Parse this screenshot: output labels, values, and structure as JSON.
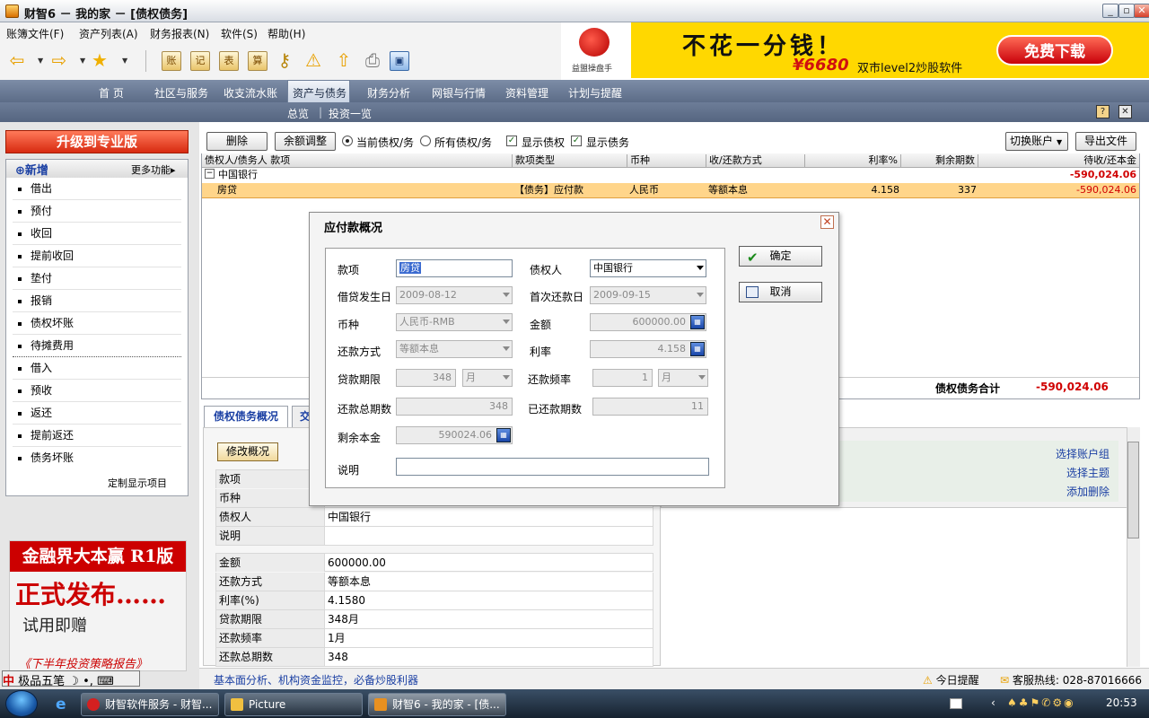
{
  "window": {
    "title": "财智6 － 我的家 － [债权债务]"
  },
  "menu": [
    "账簿文件(F)",
    "资产列表(A)",
    "财务报表(N)",
    "软件(S)",
    "帮助(H)"
  ],
  "banner": {
    "headline": "不花一分钱！",
    "price": "¥6680",
    "desc": "双市level2炒股软件",
    "download": "免费下载",
    "logo_text": "益盟操盘手"
  },
  "nav": {
    "tabs": [
      "首 页",
      "社区与服务",
      "收支流水账",
      "资产与债务",
      "财务分析",
      "网银与行情",
      "资料管理",
      "计划与提醒"
    ],
    "active": "资产与债务",
    "sub": [
      "总览",
      "投资一览"
    ]
  },
  "sidebar": {
    "upgrade": "升级到专业版",
    "add": "新增",
    "more": "更多功能",
    "items": [
      "借出",
      "预付",
      "收回",
      "提前收回",
      "垫付",
      "报销",
      "债权坏账",
      "待摊费用",
      "借入",
      "预收",
      "返还",
      "提前返还",
      "债务坏账"
    ],
    "customize": "定制显示项目"
  },
  "ad": {
    "line1": "金融界大本赢 R1版",
    "line2": "正式发布……",
    "line3": "试用即赠",
    "line4": "《下半年投资策略报告》"
  },
  "ime": {
    "label": "极品五笔"
  },
  "toolbar": {
    "delete": "删除",
    "balance_adjust": "余额调整",
    "radio_current": "当前债权/务",
    "radio_all": "所有债权/务",
    "chk_credit": "显示债权",
    "chk_debt": "显示债务",
    "switch_account": "切换账户",
    "export": "导出文件"
  },
  "grid": {
    "columns": [
      "债权人/债务人 款项",
      "款项类型",
      "币种",
      "收/还款方式",
      "利率%",
      "剩余期数",
      "待收/还本金"
    ],
    "group": {
      "name": "中国银行",
      "amount": "-590,024.06"
    },
    "rows": [
      {
        "item": "房贷",
        "type": "【债务】应付款",
        "currency": "人民币",
        "method": "等额本息",
        "rate": "4.158",
        "remaining": "337",
        "amount": "-590,024.06"
      }
    ],
    "total_label": "债权债务合计",
    "total_value": "-590,024.06"
  },
  "lower": {
    "tab1": "债权债务概况",
    "tab2": "交",
    "modify": "修改概况",
    "rows_a": [
      {
        "k": "款项",
        "v": ""
      },
      {
        "k": "币种",
        "v": ""
      },
      {
        "k": "债权人",
        "v": "中国银行"
      },
      {
        "k": "说明",
        "v": ""
      }
    ],
    "rows_b": [
      {
        "k": "金额",
        "v": "600000.00"
      },
      {
        "k": "还款方式",
        "v": "等额本息"
      },
      {
        "k": "利率(%)",
        "v": "4.1580"
      },
      {
        "k": "贷款期限",
        "v": "348月"
      },
      {
        "k": "还款频率",
        "v": "1月"
      },
      {
        "k": "还款总期数",
        "v": "348"
      }
    ],
    "links": [
      "选择账户组",
      "选择主题",
      "添加删除"
    ]
  },
  "status": {
    "tip": "基本面分析、机构资金监控，必备炒股利器",
    "reminder": "今日提醒",
    "hotline": "客服热线: 028-87016666"
  },
  "taskbar": {
    "items": [
      "财智软件服务 - 财智...",
      "Picture",
      "财智6 - 我的家 - [债..."
    ],
    "clock": "20:53"
  },
  "dialog": {
    "title": "应付款概况",
    "ok": "确定",
    "cancel": "取消",
    "fields": {
      "item_label": "款项",
      "item_value": "房贷",
      "creditor_label": "债权人",
      "creditor_value": "中国银行",
      "loan_date_label": "借贷发生日",
      "loan_date_value": "2009-08-12",
      "first_pay_label": "首次还款日",
      "first_pay_value": "2009-09-15",
      "currency_label": "币种",
      "currency_value": "人民币-RMB",
      "amount_label": "金额",
      "amount_value": "600000.00",
      "method_label": "还款方式",
      "method_value": "等额本息",
      "rate_label": "利率",
      "rate_value": "4.158",
      "term_label": "贷款期限",
      "term_value": "348",
      "term_unit": "月",
      "freq_label": "还款频率",
      "freq_value": "1",
      "freq_unit": "月",
      "total_periods_label": "还款总期数",
      "total_periods_value": "348",
      "paid_periods_label": "已还款期数",
      "paid_periods_value": "11",
      "principal_label": "剩余本金",
      "principal_value": "590024.06",
      "note_label": "说明",
      "note_value": ""
    }
  }
}
